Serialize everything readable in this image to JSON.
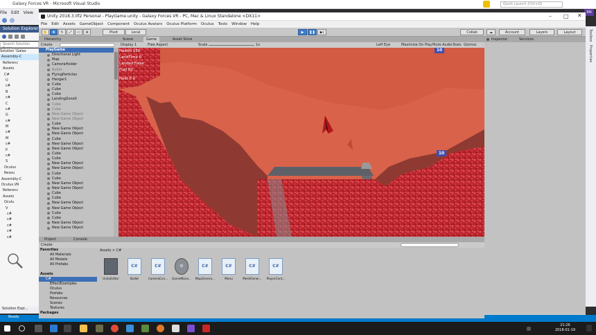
{
  "vs": {
    "title": "Galaxy Forces VR - Microsoft Visual Studio",
    "menu": [
      "File",
      "Edit",
      "View"
    ],
    "quick_launch_placeholder": "Quick Launch (Ctrl+Q)",
    "user_badge": "RN",
    "solution_explorer": {
      "title": "Solution Explorer",
      "search_placeholder": "Search Solution Explo",
      "items": [
        "Solution 'Galax",
        "Assembly-C",
        "Referenc",
        "Assets",
        "C#",
        "U",
        "c#",
        "B",
        "c#",
        "C",
        "c#",
        "G",
        "c#",
        "M",
        "c#",
        "M",
        "c#",
        "P",
        "c#",
        "S",
        "Oculus",
        "Resou",
        "Assembly-C",
        "Oculus.VR",
        "Referenc",
        "Assets",
        "Oculu",
        "V",
        "c#",
        "c#",
        "c#",
        "c#",
        "c#"
      ]
    },
    "bottom_tab": "Solution Expl...",
    "status": "Ready",
    "right_tabs": [
      "Toolbox",
      "Properties"
    ]
  },
  "unity": {
    "title": "Unity 2018.3.0f2 Personal - PlayGame.unity - Galaxy Forces VR - PC, Mac & Linux Standalone <DX11>",
    "menu": [
      "File",
      "Edit",
      "Assets",
      "GameObject",
      "Component",
      "Oculus Avatars",
      "Oculus Platform",
      "Oculus",
      "Tools",
      "Window",
      "Help"
    ],
    "toolbar": {
      "pivot": "Pivot",
      "local": "Local",
      "collab": "Collab",
      "account": "Account",
      "layers": "Layers",
      "layout": "Layout"
    },
    "hierarchy": {
      "tab": "Hierarchy",
      "create": "Create",
      "root": "PlayGame",
      "items": [
        {
          "label": "Directional Light",
          "dim": false
        },
        {
          "label": "Map",
          "dim": false
        },
        {
          "label": "CameraHolder",
          "dim": false
        },
        {
          "label": "Bullet",
          "dim": true
        },
        {
          "label": "FlyingParticles",
          "dim": false
        },
        {
          "label": "Hangar1",
          "dim": false
        },
        {
          "label": "Cube",
          "dim": false
        },
        {
          "label": "Cube",
          "dim": false
        },
        {
          "label": "Cube",
          "dim": false
        },
        {
          "label": "LandingZone0",
          "dim": false
        },
        {
          "label": "Cube",
          "dim": true
        },
        {
          "label": "Cube",
          "dim": true
        },
        {
          "label": "New Game Object",
          "dim": true
        },
        {
          "label": "New Game Object",
          "dim": true
        },
        {
          "label": "Cube",
          "dim": false
        },
        {
          "label": "New Game Object",
          "dim": false
        },
        {
          "label": "New Game Object",
          "dim": false
        },
        {
          "label": "Cube",
          "dim": false
        },
        {
          "label": "New Game Object",
          "dim": false
        },
        {
          "label": "New Game Object",
          "dim": false
        },
        {
          "label": "Cube",
          "dim": false
        },
        {
          "label": "Cube",
          "dim": false
        },
        {
          "label": "New Game Object",
          "dim": false
        },
        {
          "label": "New Game Object",
          "dim": false
        },
        {
          "label": "Cube",
          "dim": false
        },
        {
          "label": "Cube",
          "dim": false
        },
        {
          "label": "New Game Object",
          "dim": false
        },
        {
          "label": "New Game Object",
          "dim": false
        },
        {
          "label": "Cube",
          "dim": false
        },
        {
          "label": "Cube",
          "dim": false
        },
        {
          "label": "New Game Object",
          "dim": false
        },
        {
          "label": "New Game Object",
          "dim": false
        },
        {
          "label": "Cube",
          "dim": false
        },
        {
          "label": "Cube",
          "dim": false
        },
        {
          "label": "New Game Object",
          "dim": false
        },
        {
          "label": "New Game Object",
          "dim": false
        }
      ]
    },
    "game": {
      "tabs": [
        "Scene",
        "Game",
        "Asset Store"
      ],
      "display": "Display 1",
      "aspect": "Free Aspect",
      "scale_label": "Scale",
      "scale_value": "1x",
      "right_options": [
        "Left Eye",
        "Maximize On Play",
        "Mute Audio",
        "Stats",
        "Gizmos"
      ],
      "hud": [
        "Health 150",
        "LandTime 0",
        "Landed False",
        "Fuel 60",
        "",
        "Hold 0 0"
      ],
      "badge_top": "10",
      "badge_mid": "10"
    },
    "inspector": {
      "tabs": [
        "Inspector",
        "Services"
      ]
    },
    "project": {
      "tabs": [
        "Project",
        "Console"
      ],
      "create": "Create",
      "breadcrumb": "Assets > C#",
      "tree": [
        {
          "label": "Favorites",
          "kind": "head"
        },
        {
          "label": "All Materials",
          "kind": "item"
        },
        {
          "label": "All Models",
          "kind": "item"
        },
        {
          "label": "All Prefabs",
          "kind": "item"
        },
        {
          "label": "",
          "kind": "item"
        },
        {
          "label": "Assets",
          "kind": "head"
        },
        {
          "label": "C#",
          "kind": "sel"
        },
        {
          "label": "EffectExamples",
          "kind": "item"
        },
        {
          "label": "Oculus",
          "kind": "item"
        },
        {
          "label": "Prefabs",
          "kind": "item"
        },
        {
          "label": "Resources",
          "kind": "item"
        },
        {
          "label": "Scenes",
          "kind": "item"
        },
        {
          "label": "Textures",
          "kind": "item"
        },
        {
          "label": "Packages",
          "kind": "head"
        }
      ],
      "assets": [
        {
          "label": "UnityEditor",
          "kind": "folder"
        },
        {
          "label": "Bullet",
          "kind": "script"
        },
        {
          "label": "CameraCon...",
          "kind": "script"
        },
        {
          "label": "GameMana...",
          "kind": "gear"
        },
        {
          "label": "MapGenera...",
          "kind": "script"
        },
        {
          "label": "Menu",
          "kind": "script"
        },
        {
          "label": "MeshGener...",
          "kind": "script"
        },
        {
          "label": "PlayerCont...",
          "kind": "script"
        }
      ]
    }
  },
  "taskbar": {
    "time": "21:26",
    "date": "2018-01-19"
  },
  "colors": {
    "sky": "#d9624a",
    "terrain": "#c2292b",
    "accent": "#3d7cc9"
  }
}
